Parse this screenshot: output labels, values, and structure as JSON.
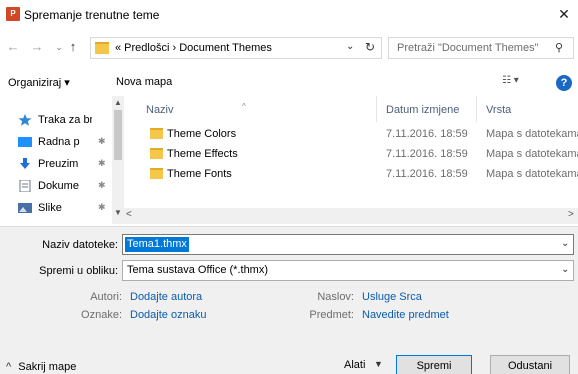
{
  "window": {
    "app_icon": "P",
    "title": "Spremanje trenutne teme",
    "close_glyph": "✕"
  },
  "address_bar": {
    "back_glyph": "←",
    "forward_glyph": "→",
    "recent_glyph": "⌄",
    "up_glyph": "↑",
    "path": "« Predlošci  ›  Document Themes",
    "dropdown_glyph": "⌄",
    "refresh_glyph": "↻",
    "search_placeholder": "Pretraži \"Document Themes\"",
    "search_glyph": "⚲"
  },
  "toolbar": {
    "organize": "Organiziraj ▾",
    "new_folder": "Nova mapa",
    "view_glyph": "☷ ▾",
    "help_glyph": "?"
  },
  "sidebar": {
    "items": [
      {
        "label": "Traka za brzi",
        "icon": "star-icon",
        "color": "#2b88d8",
        "pinned": false
      },
      {
        "label": "Radna p",
        "icon": "desktop-icon",
        "color": "#1e90ff",
        "pinned": true
      },
      {
        "label": "Preuzim",
        "icon": "download-icon",
        "color": "#1e6fd9",
        "pinned": true
      },
      {
        "label": "Dokume",
        "icon": "document-icon",
        "color": "#6a7a8c",
        "pinned": true
      },
      {
        "label": "Slike",
        "icon": "pictures-icon",
        "color": "#4a6fa5",
        "pinned": true
      }
    ],
    "pin_glyph": "✱",
    "scroll_up": "▲",
    "scroll_down": "▼"
  },
  "file_list": {
    "columns": {
      "name": "Naziv",
      "date": "Datum izmjene",
      "type": "Vrsta"
    },
    "sort_glyph": "^",
    "rows": [
      {
        "name": "Theme Colors",
        "date": "7.11.2016. 18:59",
        "type": "Mapa s datotekama"
      },
      {
        "name": "Theme Effects",
        "date": "7.11.2016. 18:59",
        "type": "Mapa s datotekama"
      },
      {
        "name": "Theme Fonts",
        "date": "7.11.2016. 18:59",
        "type": "Mapa s datotekama"
      }
    ],
    "hscroll_left": "<",
    "hscroll_right": ">"
  },
  "form": {
    "filename_label": "Naziv datoteke:",
    "filename_value": "Tema1.thmx",
    "filetype_label": "Spremi u obliku:",
    "filetype_value": "Tema sustava Office (*.thmx)",
    "dropdown_glyph": "⌄",
    "authors_label": "Autori:",
    "authors_value": "Dodajte autora",
    "tags_label": "Oznake:",
    "tags_value": "Dodajte oznaku",
    "title_label": "Naslov:",
    "title_value": "Usluge Srca",
    "subject_label": "Predmet:",
    "subject_value": "Navedite predmet"
  },
  "footer": {
    "hide_caret": "^",
    "hide_folders": "Sakrij mape",
    "tools": "Alati",
    "tools_caret": "▼",
    "save": "Spremi",
    "cancel": "Odustani"
  },
  "colors": {
    "accent": "#0078d7",
    "folder": "#f4c64a",
    "link": "#0b5cad"
  }
}
